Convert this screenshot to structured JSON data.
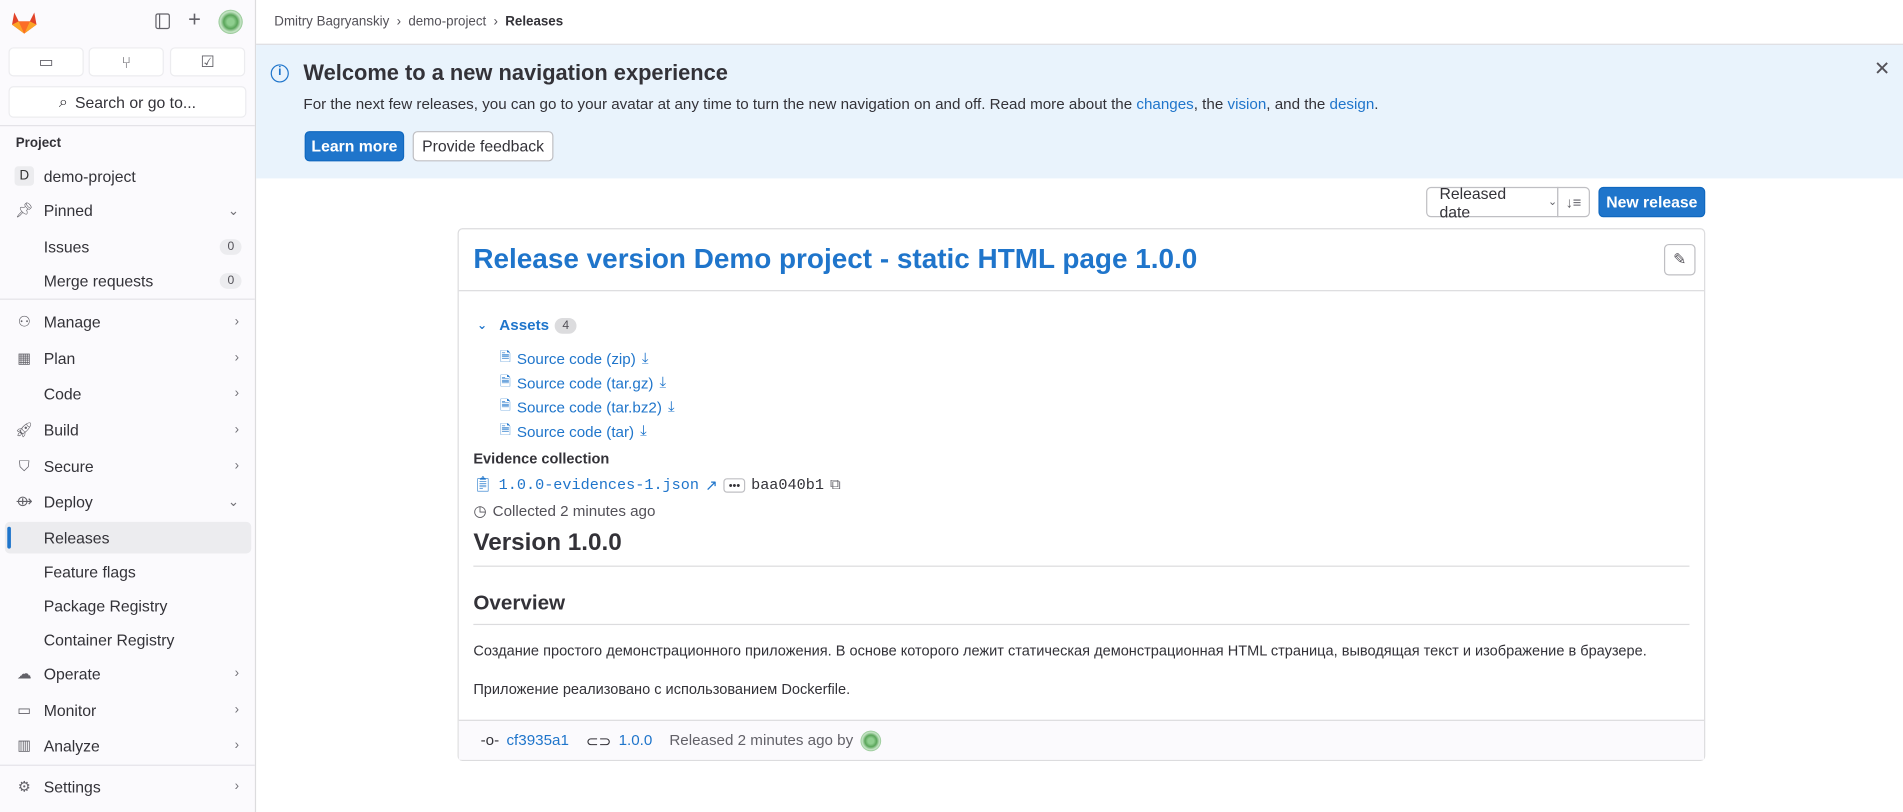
{
  "sidebar": {
    "project_label": "Project",
    "search_label": "Search or go to...",
    "project_name": "demo-project",
    "project_initial": "D",
    "items": [
      {
        "label": "Pinned",
        "icon": "pin-icon",
        "chev": "⌄"
      },
      {
        "label": "Issues",
        "count": "0"
      },
      {
        "label": "Merge requests",
        "count": "0"
      },
      {
        "label": "Manage",
        "icon": "users-icon",
        "chev": "›"
      },
      {
        "label": "Plan",
        "icon": "calendar-icon",
        "chev": "›"
      },
      {
        "label": "Code",
        "icon": "code-icon",
        "chev": "›"
      },
      {
        "label": "Build",
        "icon": "rocket-icon",
        "chev": "›"
      },
      {
        "label": "Secure",
        "icon": "shield-icon",
        "chev": "›"
      },
      {
        "label": "Deploy",
        "icon": "deploy-icon",
        "chev": "⌄"
      },
      {
        "label": "Releases"
      },
      {
        "label": "Feature flags"
      },
      {
        "label": "Package Registry"
      },
      {
        "label": "Container Registry"
      },
      {
        "label": "Operate",
        "icon": "cloud-icon",
        "chev": "›"
      },
      {
        "label": "Monitor",
        "icon": "monitor-icon",
        "chev": "›"
      },
      {
        "label": "Analyze",
        "icon": "chart-icon",
        "chev": "›"
      },
      {
        "label": "Settings",
        "icon": "gear-icon",
        "chev": "›"
      }
    ]
  },
  "breadcrumb": [
    "Dmitry Bagryanskiy",
    "demo-project",
    "Releases"
  ],
  "banner": {
    "title": "Welcome to a new navigation experience",
    "text_before": "For the next few releases, you can go to your avatar at any time to turn the new navigation on and off. Read more about the ",
    "link1": "changes",
    "sep1": ", the ",
    "link2": "vision",
    "sep2": ", and the ",
    "link3": "design",
    "end": ".",
    "learn_more": "Learn more",
    "feedback": "Provide feedback"
  },
  "controls": {
    "sort": "Released date",
    "new_release": "New release"
  },
  "release": {
    "title": "Release version Demo project - static HTML page 1.0.0",
    "assets_label": "Assets",
    "assets_count": "4",
    "assets": [
      "Source code (zip)",
      "Source code (tar.gz)",
      "Source code (tar.bz2)",
      "Source code (tar)"
    ],
    "evidence_label": "Evidence collection",
    "evidence_file": "1.0.0-evidences-1.json",
    "evidence_sha": "baa040b1",
    "collected": "Collected 2 minutes ago",
    "version_heading": "Version 1.0.0",
    "overview_heading": "Overview",
    "para1": "Создание простого демонстрационного приложения. В основе которого лежит статическая демонстрационная HTML страница, выводящая текст и изображение в браузере.",
    "para2": "Приложение реализовано с использованием Dockerfile.",
    "commit": "cf3935a1",
    "tag": "1.0.0",
    "released": "Released 2 minutes ago by"
  },
  "colors": {
    "accent": "#1f75cb",
    "banner_bg": "#e9f3fc"
  }
}
